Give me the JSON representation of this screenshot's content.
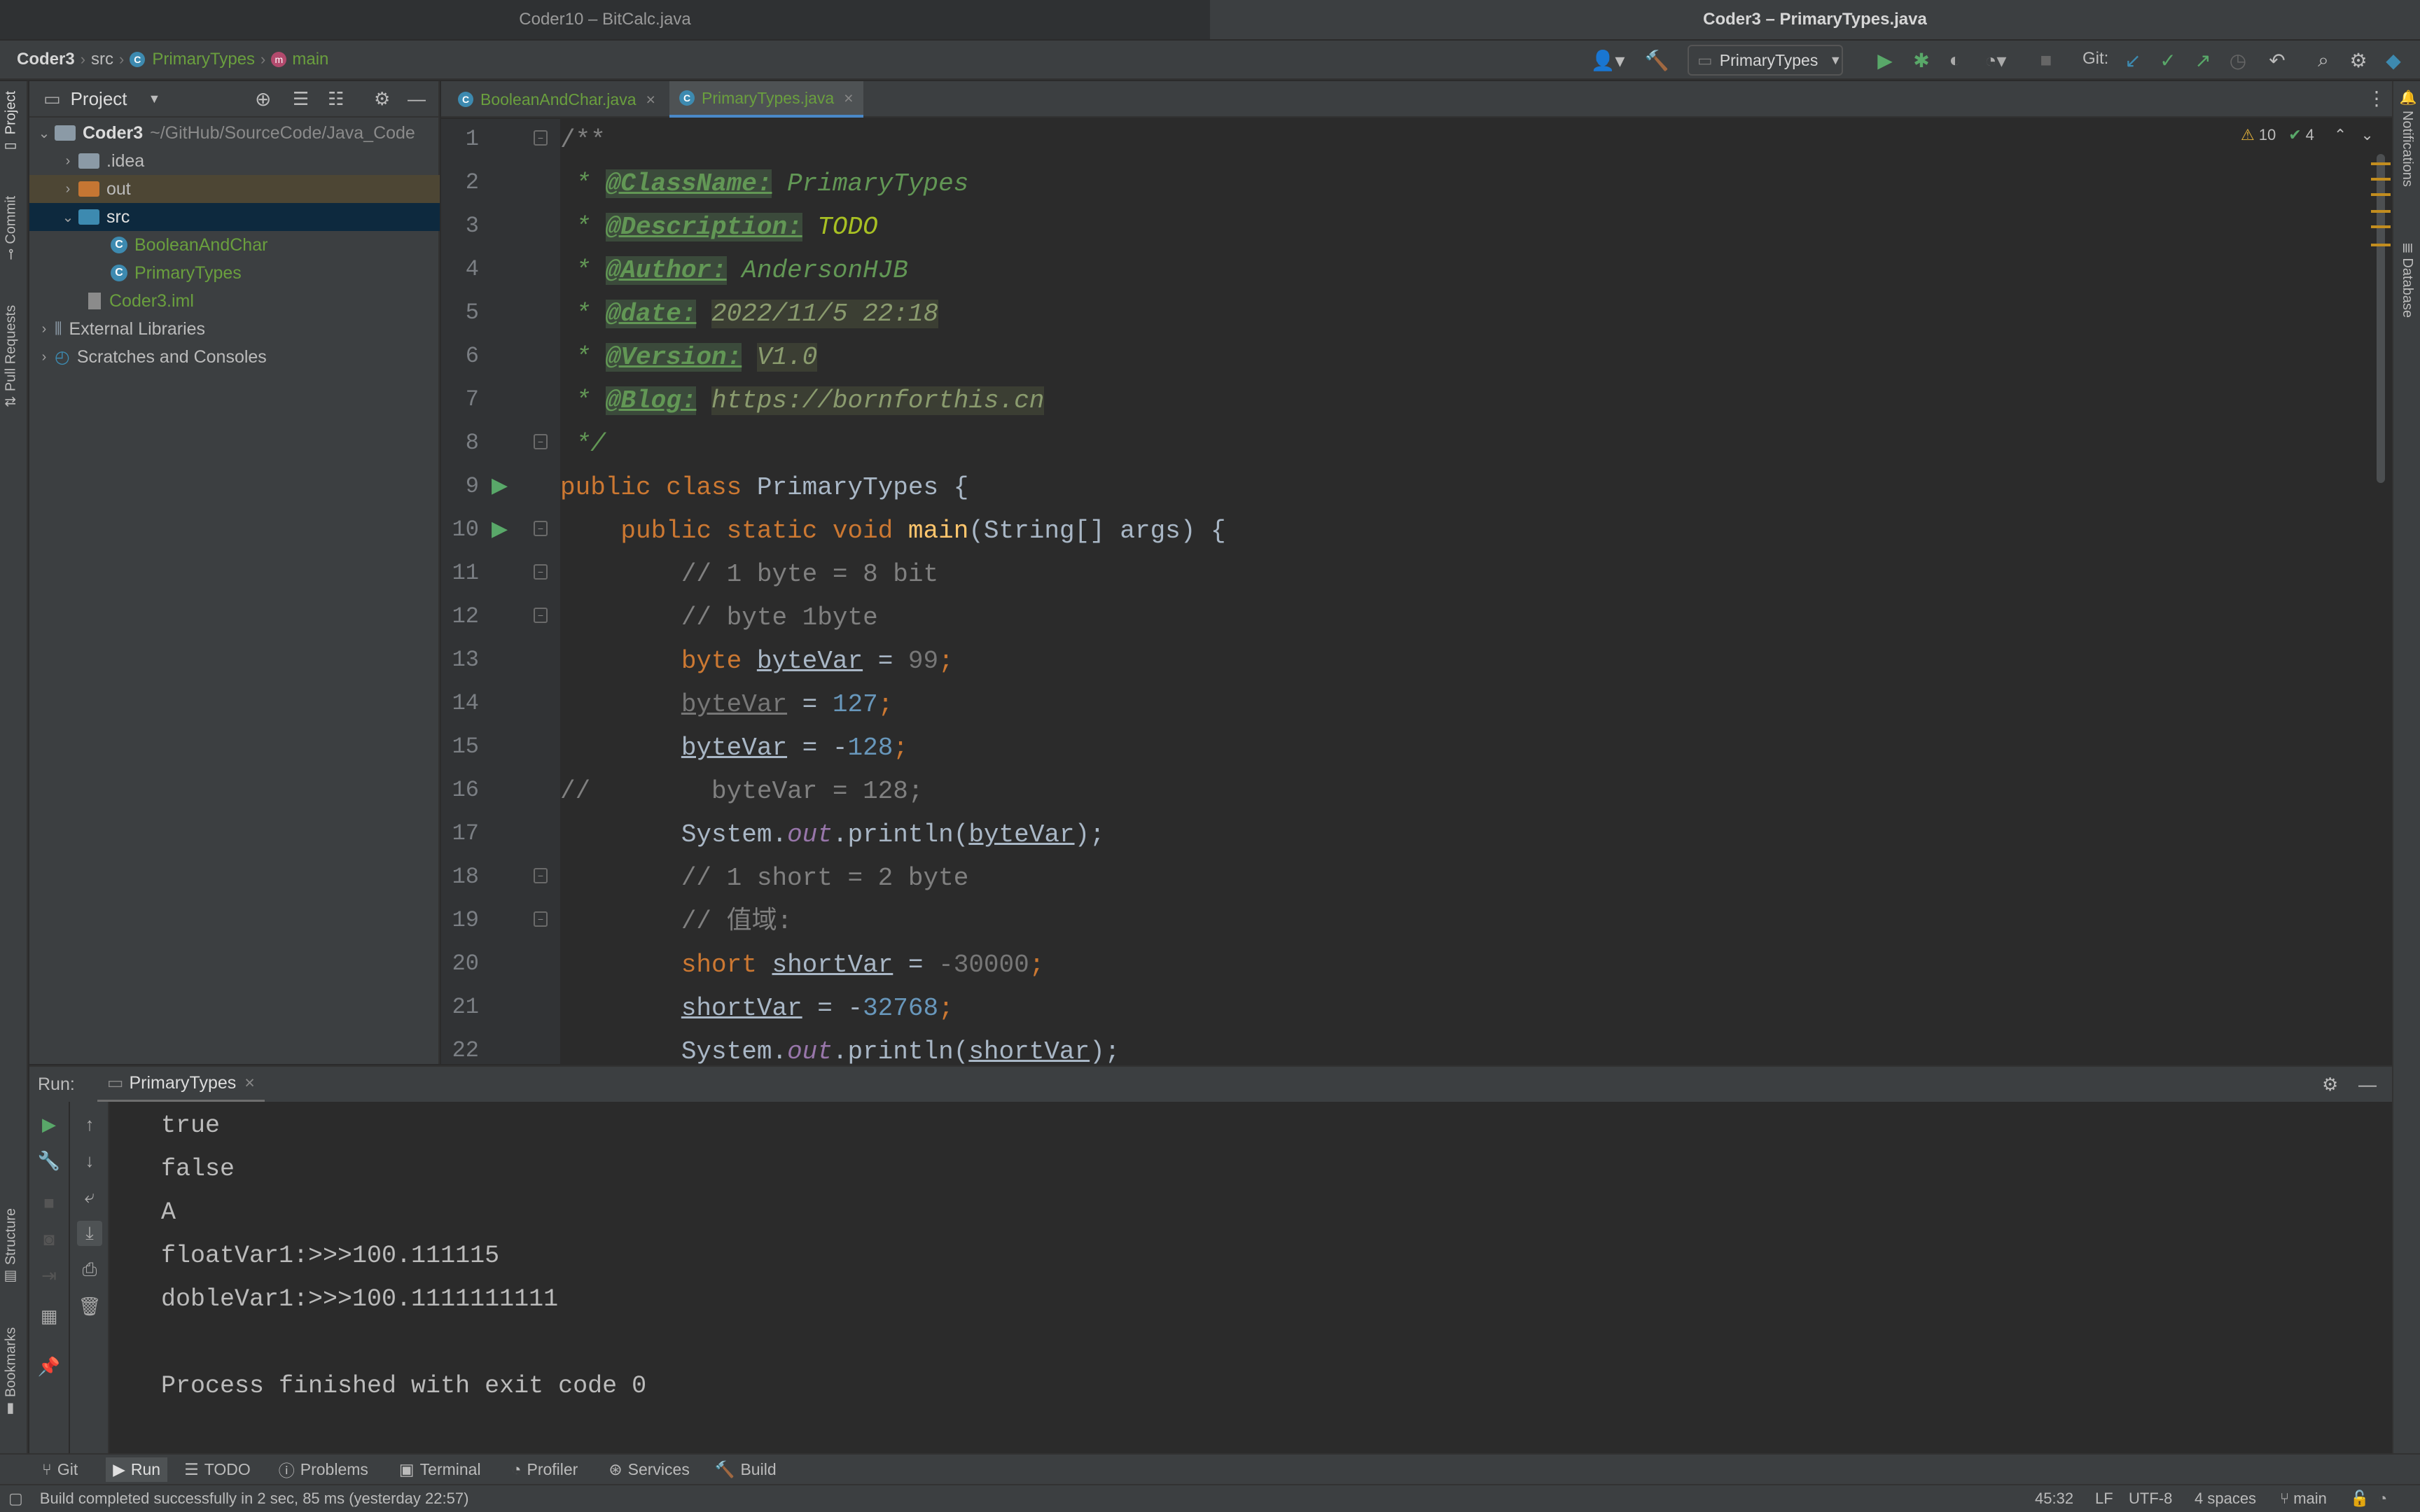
{
  "window_tabs": [
    "Coder10 – BitCalc.java",
    "Coder3 – PrimaryTypes.java"
  ],
  "breadcrumb": [
    "Coder3",
    "src",
    "PrimaryTypes",
    "main"
  ],
  "run_config": "PrimaryTypes",
  "git_label": "Git:",
  "project_panel": {
    "title": "Project",
    "root": {
      "name": "Coder3",
      "path": "~/GitHub/SourceCode/Java_Code"
    },
    "items": [
      ".idea",
      "out",
      "src",
      "BooleanAndChar",
      "PrimaryTypes",
      "Coder3.iml",
      "External Libraries",
      "Scratches and Consoles"
    ]
  },
  "left_stripe": [
    "Project",
    "Commit",
    "Pull Requests",
    "Structure",
    "Bookmarks"
  ],
  "right_stripe": [
    "Notifications",
    "Database"
  ],
  "editor_tabs": [
    "BooleanAndChar.java",
    "PrimaryTypes.java"
  ],
  "inspections": {
    "warnings": "10",
    "ok": "4"
  },
  "line_numbers": [
    "1",
    "2",
    "3",
    "4",
    "5",
    "6",
    "7",
    "8",
    "9",
    "10",
    "11",
    "12",
    "13",
    "14",
    "15",
    "16",
    "17",
    "18",
    "19",
    "20",
    "21",
    "22"
  ],
  "code": {
    "l1": "/**",
    "l2_tag": "@ClassName:",
    "l2_val": "PrimaryTypes",
    "l3_tag": "@Description:",
    "l3_val": "TODO",
    "l4_tag": "@Author:",
    "l4_val": "AndersonHJB",
    "l5_tag": "@date:",
    "l5_val": "2022/11/5 22:18",
    "l6_tag": "@Version:",
    "l6_val": "V1.0",
    "l7_tag": "@Blog:",
    "l7_val": "https://bornforthis.cn",
    "l8": "*/",
    "l9_kw": "public class",
    "l9_rest": "PrimaryTypes {",
    "l10_kw": "public static void",
    "l10_fn": "main",
    "l10_rest": "(String[] args) {",
    "l11": "// 1 byte = 8 bit",
    "l12": "// byte 1byte",
    "l13_kw": "byte",
    "l13_var": "byteVar",
    "l13_eq": " = ",
    "l13_num": "99",
    "l13_end": ";",
    "l14_var": "byteVar",
    "l14_eq": " = ",
    "l14_num": "127",
    "l14_end": ";",
    "l15_var": "byteVar",
    "l15_eq": " = -",
    "l15_num": "128",
    "l15_end": ";",
    "l16_cm": "//",
    "l16_rest": "byteVar = 128;",
    "l17_a": "System.",
    "l17_out": "out",
    "l17_b": ".println(",
    "l17_var": "byteVar",
    "l17_c": ");",
    "l18": "// 1 short = 2 byte",
    "l19": "// 值域:",
    "l20_kw": "short",
    "l20_var": "shortVar",
    "l20_eq": " = ",
    "l20_num": "-30000",
    "l20_end": ";",
    "l21_var": "shortVar",
    "l21_eq": " = -",
    "l21_num": "32768",
    "l21_end": ";",
    "l22_a": "System.",
    "l22_out": "out",
    "l22_b": ".println(",
    "l22_var": "shortVar",
    "l22_c": ");"
  },
  "run_panel": {
    "label": "Run:",
    "tab": "PrimaryTypes",
    "output": [
      "true",
      "false",
      "A",
      "floatVar1:>>>100.111115",
      "dobleVar1:>>>100.1111111111",
      "",
      "Process finished with exit code 0"
    ]
  },
  "bottom_tools": [
    "Git",
    "Run",
    "TODO",
    "Problems",
    "Terminal",
    "Profiler",
    "Services",
    "Build"
  ],
  "status": {
    "message": "Build completed successfully in 2 sec, 85 ms (yesterday 22:57)",
    "position": "45:32",
    "line_sep": "LF",
    "encoding": "UTF-8",
    "indent": "4 spaces",
    "branch": "main"
  }
}
